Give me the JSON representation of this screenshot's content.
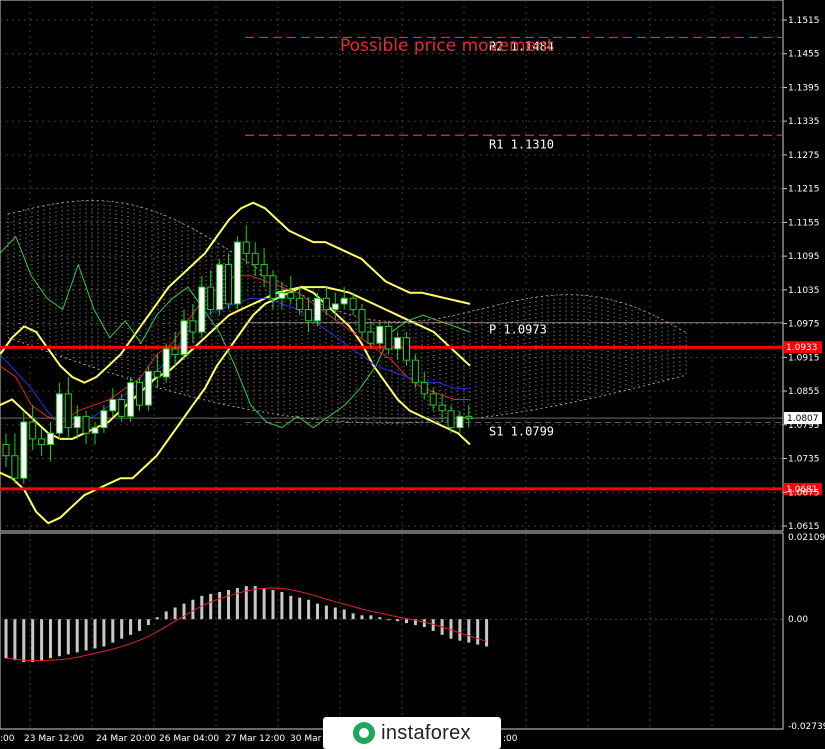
{
  "chart_data": [
    {
      "type": "line",
      "title": "",
      "xlabel": "",
      "ylabel": "",
      "ylim": [
        1.06,
        1.156
      ],
      "y_ticks": [
        "1.1515",
        "1.1455",
        "1.1395",
        "1.1335",
        "1.1275",
        "1.1215",
        "1.1155",
        "1.1095",
        "1.1035",
        "1.0975",
        "1.0915",
        "1.0855",
        "1.0795",
        "1.0735",
        "1.0675",
        "1.0615"
      ],
      "x_tick_labels": [
        "23 Mar 12:00",
        "24 Mar 20:00",
        "26 Mar 04:00",
        "27 Mar 12:00",
        "30 Mar 20:00"
      ],
      "annotation": "Possible price movement",
      "levels": [
        {
          "name": "R2",
          "label": "R2 1.1484",
          "value": 1.1484,
          "color": "#e03030",
          "style": "dashed"
        },
        {
          "name": "R1",
          "label": "R1 1.1310",
          "value": 1.131,
          "color": "#e03030",
          "style": "dashed"
        },
        {
          "name": "P",
          "label": "P 1.0973",
          "value": 1.0973,
          "color": "#c8a0a0",
          "style": "thin"
        },
        {
          "name": "S1",
          "label": "S1 1.0799",
          "value": 1.0799,
          "color": "#909090",
          "style": "dashed"
        },
        {
          "name": "support_high",
          "label": "1.0933",
          "value": 1.0933,
          "color": "#ff0000",
          "style": "solid"
        },
        {
          "name": "support_low",
          "label": "1.0681",
          "value": 1.0681,
          "color": "#ff0000",
          "style": "solid"
        },
        {
          "name": "current",
          "label": "1.0807",
          "value": 1.0807,
          "color": "#b0b0b0",
          "style": "thin"
        }
      ],
      "candles": [
        [
          1.076,
          1.078,
          1.072,
          1.074
        ],
        [
          1.074,
          1.078,
          1.069,
          1.07
        ],
        [
          1.07,
          1.082,
          1.069,
          1.08
        ],
        [
          1.08,
          1.083,
          1.075,
          1.077
        ],
        [
          1.077,
          1.079,
          1.074,
          1.076
        ],
        [
          1.076,
          1.08,
          1.073,
          1.078
        ],
        [
          1.078,
          1.087,
          1.077,
          1.085
        ],
        [
          1.085,
          1.088,
          1.077,
          1.079
        ],
        [
          1.079,
          1.083,
          1.077,
          1.081
        ],
        [
          1.081,
          1.082,
          1.076,
          1.078
        ],
        [
          1.078,
          1.08,
          1.076,
          1.079
        ],
        [
          1.079,
          1.083,
          1.078,
          1.082
        ],
        [
          1.082,
          1.086,
          1.081,
          1.084
        ],
        [
          1.084,
          1.085,
          1.08,
          1.081
        ],
        [
          1.081,
          1.088,
          1.08,
          1.087
        ],
        [
          1.087,
          1.088,
          1.082,
          1.083
        ],
        [
          1.083,
          1.09,
          1.082,
          1.089
        ],
        [
          1.089,
          1.092,
          1.086,
          1.088
        ],
        [
          1.088,
          1.094,
          1.087,
          1.093
        ],
        [
          1.093,
          1.096,
          1.09,
          1.092
        ],
        [
          1.092,
          1.1,
          1.091,
          1.098
        ],
        [
          1.098,
          1.101,
          1.094,
          1.096
        ],
        [
          1.096,
          1.106,
          1.095,
          1.104
        ],
        [
          1.104,
          1.107,
          1.099,
          1.1
        ],
        [
          1.1,
          1.109,
          1.099,
          1.108
        ],
        [
          1.108,
          1.11,
          1.1,
          1.101
        ],
        [
          1.101,
          1.113,
          1.1,
          1.112
        ],
        [
          1.112,
          1.115,
          1.108,
          1.11
        ],
        [
          1.11,
          1.112,
          1.106,
          1.108
        ],
        [
          1.108,
          1.111,
          1.104,
          1.106
        ],
        [
          1.106,
          1.107,
          1.1,
          1.102
        ],
        [
          1.102,
          1.105,
          1.1,
          1.103
        ],
        [
          1.103,
          1.106,
          1.101,
          1.102
        ],
        [
          1.102,
          1.104,
          1.099,
          1.1
        ],
        [
          1.1,
          1.102,
          1.096,
          1.098
        ],
        [
          1.098,
          1.103,
          1.097,
          1.102
        ],
        [
          1.102,
          1.104,
          1.099,
          1.1
        ],
        [
          1.1,
          1.103,
          1.098,
          1.101
        ],
        [
          1.101,
          1.104,
          1.1,
          1.102
        ],
        [
          1.102,
          1.103,
          1.099,
          1.1
        ],
        [
          1.1,
          1.101,
          1.095,
          1.096
        ],
        [
          1.096,
          1.098,
          1.093,
          1.094
        ],
        [
          1.094,
          1.098,
          1.093,
          1.097
        ],
        [
          1.097,
          1.098,
          1.092,
          1.093
        ],
        [
          1.093,
          1.096,
          1.091,
          1.095
        ],
        [
          1.095,
          1.096,
          1.09,
          1.091
        ],
        [
          1.091,
          1.092,
          1.086,
          1.087
        ],
        [
          1.087,
          1.089,
          1.084,
          1.085
        ],
        [
          1.085,
          1.086,
          1.082,
          1.083
        ],
        [
          1.083,
          1.085,
          1.08,
          1.082
        ],
        [
          1.082,
          1.083,
          1.078,
          1.079
        ],
        [
          1.079,
          1.082,
          1.078,
          1.081
        ],
        [
          1.081,
          1.083,
          1.079,
          1.0807
        ]
      ],
      "series": [
        {
          "name": "",
          "color": "#ffff66",
          "values": [
            1.083,
            1.084,
            1.082,
            1.08,
            1.078,
            1.077,
            1.077,
            1.078,
            1.079,
            1.08,
            1.082,
            1.084,
            1.086,
            1.088,
            1.089,
            1.091,
            1.093,
            1.095,
            1.097,
            1.099,
            1.1,
            1.101,
            1.102,
            1.103,
            1.1035,
            1.104,
            1.104,
            1.104,
            1.1035,
            1.103,
            1.102,
            1.101,
            1.1,
            1.099,
            1.098,
            1.097,
            1.096,
            1.094,
            1.092,
            1.09
          ]
        },
        {
          "name": "",
          "color": "#ffff66",
          "values": [
            1.092,
            1.095,
            1.097,
            1.096,
            1.093,
            1.09,
            1.088,
            1.087,
            1.088,
            1.09,
            1.092,
            1.095,
            1.098,
            1.101,
            1.104,
            1.106,
            1.108,
            1.11,
            1.113,
            1.116,
            1.118,
            1.119,
            1.118,
            1.116,
            1.114,
            1.113,
            1.112,
            1.112,
            1.111,
            1.11,
            1.109,
            1.107,
            1.105,
            1.104,
            1.103,
            1.103,
            1.1025,
            1.102,
            1.1015,
            1.101
          ]
        },
        {
          "name": "",
          "color": "#ffff66",
          "values": [
            1.071,
            1.07,
            1.068,
            1.064,
            1.062,
            1.063,
            1.065,
            1.067,
            1.068,
            1.069,
            1.07,
            1.07,
            1.072,
            1.074,
            1.077,
            1.08,
            1.083,
            1.086,
            1.09,
            1.093,
            1.096,
            1.099,
            1.101,
            1.102,
            1.103,
            1.104,
            1.103,
            1.101,
            1.099,
            1.097,
            1.094,
            1.09,
            1.087,
            1.084,
            1.082,
            1.081,
            1.08,
            1.079,
            1.078,
            1.076
          ]
        }
      ]
    },
    {
      "type": "bar",
      "title": "",
      "ylim": [
        -0.02739,
        0.02109
      ],
      "y_ticks": [
        "0.02109",
        "0.00",
        "-0.02739"
      ],
      "values": [
        -0.01,
        -0.0105,
        -0.011,
        -0.011,
        -0.0105,
        -0.01,
        -0.0095,
        -0.009,
        -0.0085,
        -0.008,
        -0.0075,
        -0.007,
        -0.006,
        -0.005,
        -0.004,
        -0.003,
        -0.0015,
        0.0005,
        0.002,
        0.003,
        0.004,
        0.005,
        0.006,
        0.0065,
        0.007,
        0.0075,
        0.008,
        0.0085,
        0.0085,
        0.008,
        0.0075,
        0.007,
        0.006,
        0.0055,
        0.005,
        0.004,
        0.0035,
        0.003,
        0.0025,
        0.0015,
        0.001,
        0.001,
        0.0005,
        0.0,
        -0.0005,
        -0.001,
        -0.0015,
        -0.002,
        -0.003,
        -0.004,
        -0.005,
        -0.0055,
        -0.006,
        -0.0065,
        -0.007
      ]
    }
  ],
  "watermark": {
    "text": "instaforex"
  }
}
